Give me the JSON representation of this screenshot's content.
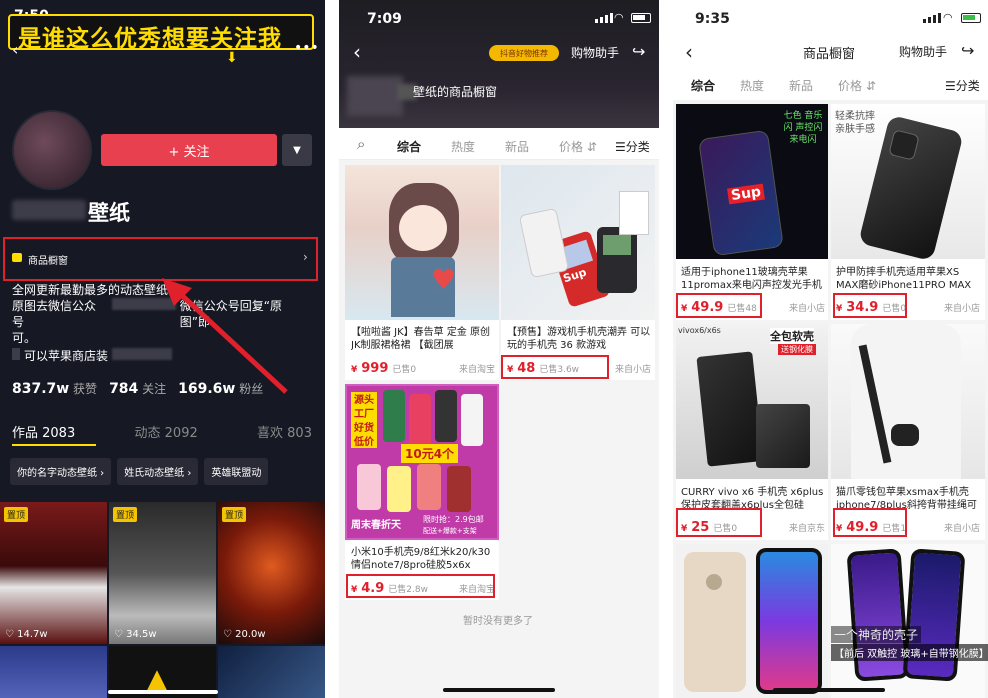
{
  "p1": {
    "time": "7:50",
    "banner": "是谁这么优秀想要关注我",
    "follow": "+ 关注",
    "name": "壁纸",
    "shop": "商品橱窗",
    "bio1": "全网更新最勤最多的动态壁纸",
    "bio2": "原图去微信公众号",
    "bio2b": "微信公众号回复“原图”即",
    "bio3": "可。",
    "bio4": "可以苹果商店装",
    "stats": [
      {
        "num": "837.7w",
        "label": "获赞"
      },
      {
        "num": "784",
        "label": "关注"
      },
      {
        "num": "169.6w",
        "label": "粉丝"
      }
    ],
    "tabs": [
      "作品 2083",
      "动态 2092",
      "喜欢 803"
    ],
    "chips": [
      "你的名字动态壁纸 ›",
      "姓氏动态壁纸 ›",
      "英雄联盟动"
    ],
    "pin": "置顶",
    "likes": [
      "14.7w",
      "34.5w",
      "20.0w"
    ],
    "colors": {
      "bg": "#161823",
      "follow": "#e9404f",
      "banner": "#ffdd00"
    }
  },
  "p2": {
    "time": "7:09",
    "helper": "购物助手",
    "badge": "抖音好物推荐",
    "shop_title": "壁纸的商品橱窗",
    "tabs": [
      "综合",
      "热度",
      "新品",
      "价格 ⇵"
    ],
    "cat": "分类",
    "items": [
      {
        "title": "【啦啦酱 JK】春告草 定金 原创 JK制服裙格裙 【截团展",
        "price": "999",
        "sold": "已售0",
        "src": "来自淘宝"
      },
      {
        "title": "【预售】游戏机手机壳潮弄 可以玩的手机壳 36 款游戏",
        "price": "48",
        "sold": "已售3.6w",
        "src": "来自小店"
      },
      {
        "title": "小米10手机壳9/8红米k20/k30情侣note7/8pro硅胶5x6x",
        "price": "4.9",
        "sold": "已售2.8w",
        "src": "来自淘宝"
      }
    ],
    "promo": {
      "a": "源头工厂",
      "b": "好货低价",
      "c": "10元4个",
      "d": "限时抢：2.9包邮",
      "e": "配送+爆款+支架",
      "f": "周末春折天"
    },
    "nomore": "暂时没有更多了",
    "sup": "Sup"
  },
  "p3": {
    "time": "9:35",
    "title": "商品橱窗",
    "helper": "购物助手",
    "tabs": [
      "综合",
      "热度",
      "新品",
      "价格 ⇵"
    ],
    "cat": "分类",
    "items": [
      {
        "title": "适用于iphone11玻璃壳苹果11promax来电闪声控发光手机",
        "price": "49.9",
        "sold": "已售48",
        "src": "来自小店",
        "tag": "七色 音乐闪 声控闪 来电闪"
      },
      {
        "title": "护甲防摔手机壳适用苹果XS MAX磨砂iPhone11PRO MAX",
        "price": "34.9",
        "sold": "已售0",
        "src": "来自小店",
        "tag": "轻柔抗摔 亲肤手感"
      },
      {
        "title": "CURRY vivo x6 手机壳 x6plus 保护皮套翻盖x6plus全包硅",
        "price": "25",
        "sold": "已售0",
        "src": "来自京东",
        "tag": "全包软壳",
        "tag2": "送钢化膜",
        "model": "vivox6/x6s"
      },
      {
        "title": "猫爪零钱包苹果xsmax手机壳iphone7/8plus斜挎背带挂绳可",
        "price": "49.9",
        "sold": "已售1",
        "src": "来自小店"
      }
    ],
    "watermark1": "一个神奇的壳子",
    "watermark2": "【前后 双触控 玻璃+自带钢化膜】",
    "sup": "Sup"
  }
}
